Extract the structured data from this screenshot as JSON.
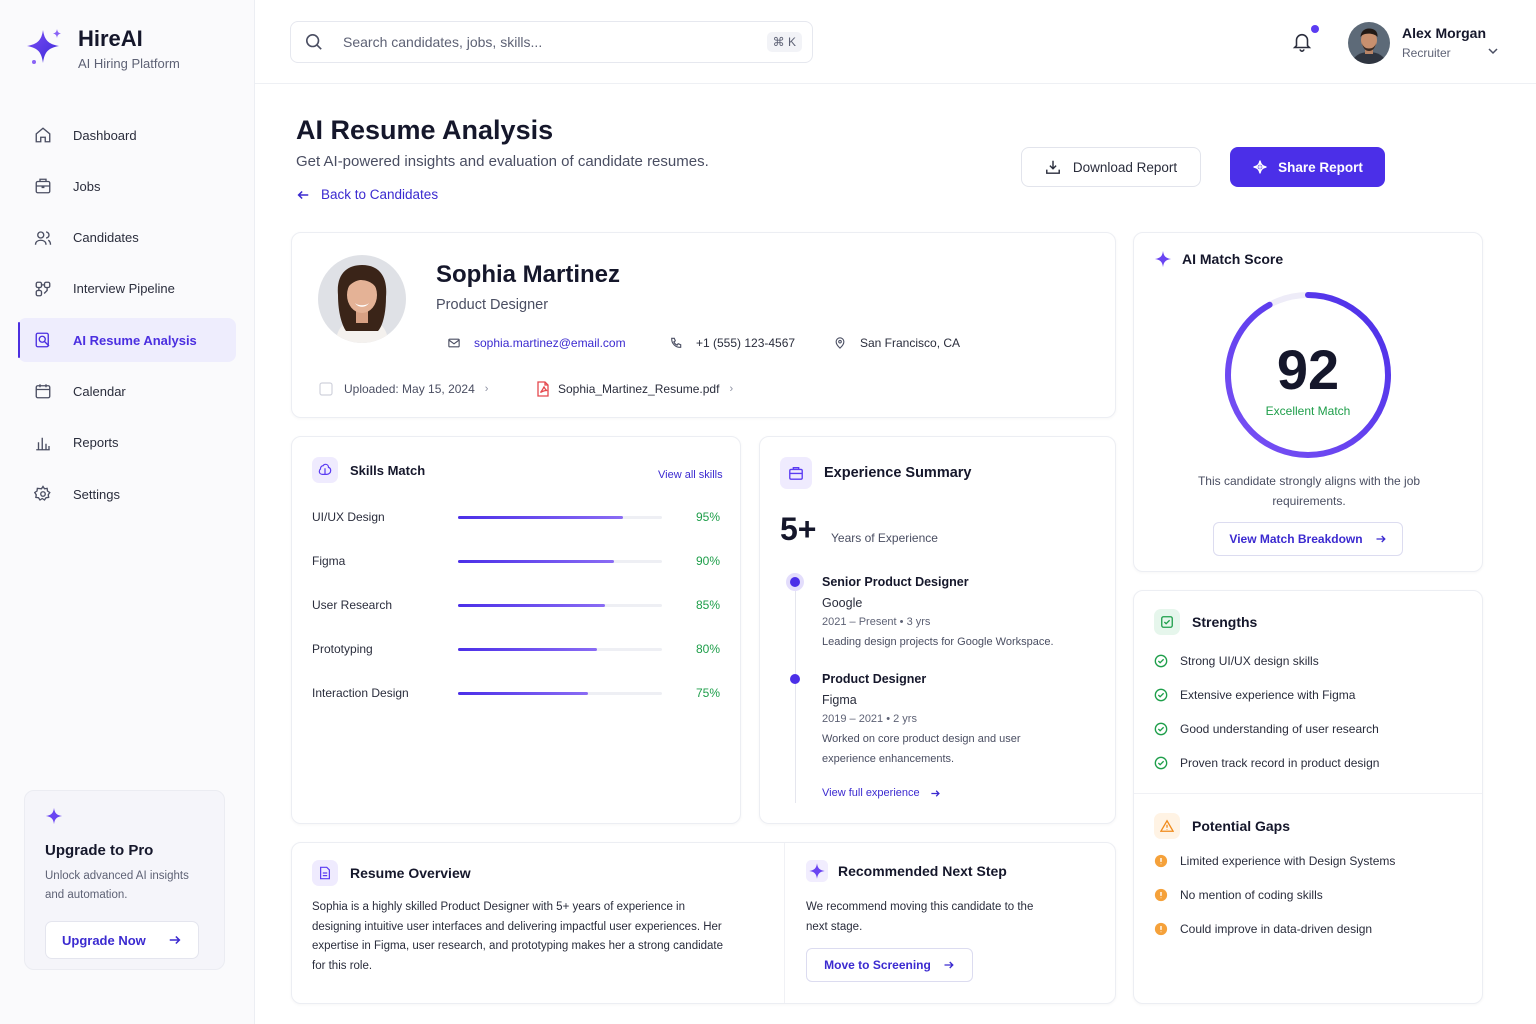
{
  "brand": {
    "name": "HireAI",
    "tagline": "AI Hiring Platform",
    "accent": "#4b2fe8"
  },
  "nav": [
    {
      "label": "Dashboard",
      "icon": "home-icon",
      "active": false
    },
    {
      "label": "Jobs",
      "icon": "briefcase-icon",
      "active": false
    },
    {
      "label": "Candidates",
      "icon": "users-icon",
      "active": false
    },
    {
      "label": "Interview Pipeline",
      "icon": "pipeline-icon",
      "active": false
    },
    {
      "label": "AI Resume Analysis",
      "icon": "resume-search-icon",
      "active": true
    },
    {
      "label": "Calendar",
      "icon": "calendar-icon",
      "active": false
    },
    {
      "label": "Reports",
      "icon": "bar-chart-icon",
      "active": false
    },
    {
      "label": "Settings",
      "icon": "gear-icon",
      "active": false
    }
  ],
  "upgrade": {
    "title": "Upgrade to Pro",
    "description": "Unlock advanced AI insights and automation.",
    "button": "Upgrade Now"
  },
  "search": {
    "placeholder": "Search candidates, jobs, skills...",
    "shortcut": "⌘ K"
  },
  "user": {
    "name": "Alex Morgan",
    "role": "Recruiter"
  },
  "header": {
    "title": "AI Resume Analysis",
    "subtitle": "Get AI-powered insights and evaluation of candidate resumes.",
    "back": "Back to Candidates",
    "download": "Download Report",
    "share": "Share Report"
  },
  "candidate": {
    "name": "Sophia Martinez",
    "role": "Product Designer",
    "email": "sophia.martinez@email.com",
    "phone": "+1 (555) 123-4567",
    "location": "San Francisco, CA",
    "uploaded": "Uploaded: May 15, 2024",
    "file": "Sophia_Martinez_Resume.pdf"
  },
  "skills": {
    "title": "Skills Match",
    "view_all": "View all skills",
    "items": [
      {
        "name": "UI/UX Design",
        "pct": 95,
        "label": "95%"
      },
      {
        "name": "Figma",
        "pct": 90,
        "label": "90%"
      },
      {
        "name": "User Research",
        "pct": 85,
        "label": "85%"
      },
      {
        "name": "Prototyping",
        "pct": 80,
        "label": "80%"
      },
      {
        "name": "Interaction Design",
        "pct": 75,
        "label": "75%"
      }
    ]
  },
  "experience": {
    "title": "Experience Summary",
    "years": "5+",
    "years_label": "Years of Experience",
    "items": [
      {
        "title": "Senior Product Designer",
        "company": "Google",
        "dates": "2021 – Present  •  3 yrs",
        "desc": "Leading design projects for Google Workspace."
      },
      {
        "title": "Product Designer",
        "company": "Figma",
        "dates": "2019 – 2021  •  2 yrs",
        "desc": "Worked on core product design and user experience enhancements."
      }
    ],
    "view_full": "View full experience"
  },
  "match": {
    "title": "AI Match Score",
    "score": 92,
    "score_text": "92",
    "label": "Excellent Match",
    "description": "This candidate strongly aligns with the job requirements.",
    "button": "View Match Breakdown"
  },
  "strengths": {
    "title": "Strengths",
    "items": [
      "Strong UI/UX design skills",
      "Extensive experience with Figma",
      "Good understanding of user research",
      "Proven track record in product design"
    ]
  },
  "gaps": {
    "title": "Potential Gaps",
    "items": [
      "Limited experience with Design Systems",
      "No mention of coding skills",
      "Could improve in data-driven design"
    ]
  },
  "overview": {
    "title": "Resume Overview",
    "text": "Sophia is a highly skilled Product Designer with 5+ years of experience in designing intuitive user interfaces and delivering impactful user experiences. Her expertise in Figma, user research, and prototyping makes her a strong candidate for this role."
  },
  "next_step": {
    "title": "Recommended Next Step",
    "text": "We recommend moving this candidate to the next stage.",
    "button": "Move to Screening"
  }
}
